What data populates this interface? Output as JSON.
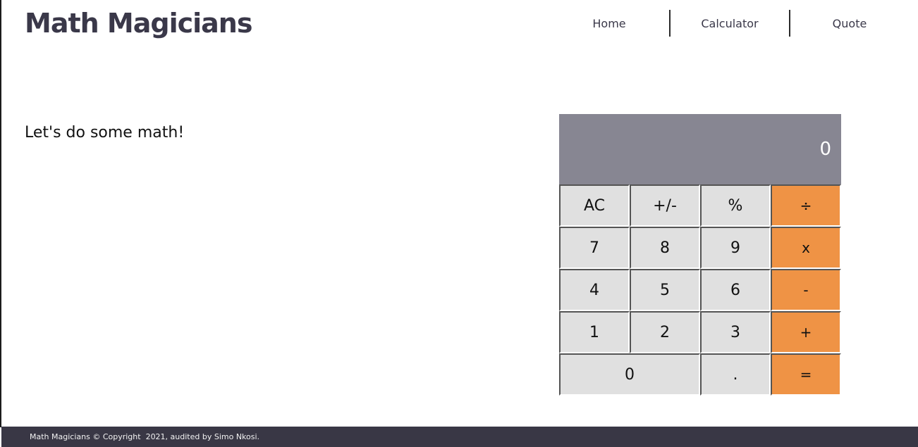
{
  "header": {
    "brand": "Math Magicians",
    "nav": [
      "Home",
      "Calculator",
      "Quote"
    ]
  },
  "main": {
    "intro": "Let's do some math!"
  },
  "calculator": {
    "display": "0",
    "keys": [
      {
        "label": "AC",
        "type": "function"
      },
      {
        "label": "+/-",
        "type": "function"
      },
      {
        "label": "%",
        "type": "function"
      },
      {
        "label": "÷",
        "type": "operator"
      },
      {
        "label": "7",
        "type": "digit"
      },
      {
        "label": "8",
        "type": "digit"
      },
      {
        "label": "9",
        "type": "digit"
      },
      {
        "label": "x",
        "type": "operator"
      },
      {
        "label": "4",
        "type": "digit"
      },
      {
        "label": "5",
        "type": "digit"
      },
      {
        "label": "6",
        "type": "digit"
      },
      {
        "label": "-",
        "type": "operator"
      },
      {
        "label": "1",
        "type": "digit"
      },
      {
        "label": "2",
        "type": "digit"
      },
      {
        "label": "3",
        "type": "digit"
      },
      {
        "label": "+",
        "type": "operator"
      },
      {
        "label": "0",
        "type": "digit"
      },
      {
        "label": ".",
        "type": "digit"
      },
      {
        "label": "=",
        "type": "operator"
      }
    ]
  },
  "footer": {
    "text": "Math Magicians © Copyright  2021, audited by Simo Nkosi."
  },
  "colors": {
    "brand": "#3a3849",
    "display_bg": "#878692",
    "key_bg": "#e0e0e0",
    "operator_bg": "#ef9345",
    "footer_bg": "#393745"
  }
}
